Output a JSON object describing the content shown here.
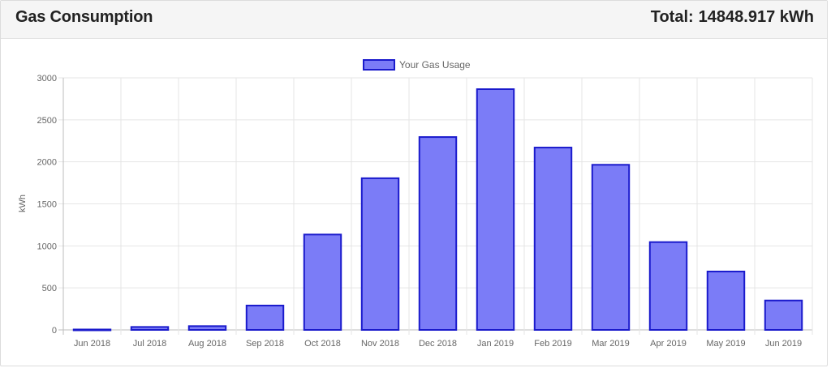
{
  "header": {
    "title": "Gas Consumption",
    "total_label": "Total:",
    "total_value": "14848.917 kWh"
  },
  "colors": {
    "bar_fill": "#7b7cf7",
    "bar_border": "#1a1acc",
    "grid": "#e5e5e5",
    "tick_text": "#666666"
  },
  "chart_data": {
    "type": "bar",
    "legend": {
      "label": "Your Gas Usage",
      "position": "top"
    },
    "categories": [
      "Jun 2018",
      "Jul 2018",
      "Aug 2018",
      "Sep 2018",
      "Oct 2018",
      "Nov 2018",
      "Dec 2018",
      "Jan 2019",
      "Feb 2019",
      "Mar 2019",
      "Apr 2019",
      "May 2019",
      "Jun 2019"
    ],
    "series": [
      {
        "name": "Your Gas Usage",
        "values": [
          5,
          35,
          45,
          290,
          1135,
          1805,
          2295,
          2865,
          2170,
          1965,
          1045,
          695,
          350
        ]
      }
    ],
    "ylabel": "kWh",
    "xlabel": "",
    "ylim": [
      0,
      3000
    ],
    "yticks": [
      0,
      500,
      1000,
      1500,
      2000,
      2500,
      3000
    ],
    "grid": true
  }
}
